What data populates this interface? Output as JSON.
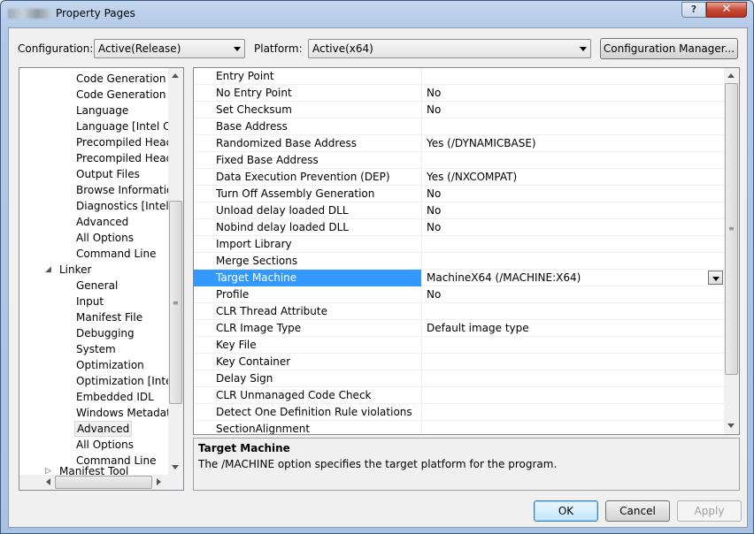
{
  "window": {
    "title": "Property Pages"
  },
  "title_buttons": {
    "help": "?",
    "close": "✕"
  },
  "config": {
    "configuration_label": "Configuration:",
    "configuration_value": "Active(Release)",
    "platform_label": "Platform:",
    "platform_value": "Active(x64)",
    "manager_button": "Configuration Manager..."
  },
  "tree": {
    "items": [
      {
        "label": "Code Generation"
      },
      {
        "label": "Code Generation [In"
      },
      {
        "label": "Language"
      },
      {
        "label": "Language [Intel C++"
      },
      {
        "label": "Precompiled Heade"
      },
      {
        "label": "Precompiled Heade"
      },
      {
        "label": "Output Files"
      },
      {
        "label": "Browse Information"
      },
      {
        "label": "Diagnostics [Intel C"
      },
      {
        "label": "Advanced"
      },
      {
        "label": "All Options"
      },
      {
        "label": "Command Line"
      },
      {
        "label": "Linker"
      },
      {
        "label": "General"
      },
      {
        "label": "Input"
      },
      {
        "label": "Manifest File"
      },
      {
        "label": "Debugging"
      },
      {
        "label": "System"
      },
      {
        "label": "Optimization"
      },
      {
        "label": "Optimization [Intel C"
      },
      {
        "label": "Embedded IDL"
      },
      {
        "label": "Windows Metadata"
      },
      {
        "label": "Advanced"
      },
      {
        "label": "All Options"
      },
      {
        "label": "Command Line"
      },
      {
        "label": "Manifest Tool"
      }
    ]
  },
  "properties": [
    {
      "name": "Entry Point",
      "value": ""
    },
    {
      "name": "No Entry Point",
      "value": "No"
    },
    {
      "name": "Set Checksum",
      "value": "No"
    },
    {
      "name": "Base Address",
      "value": ""
    },
    {
      "name": "Randomized Base Address",
      "value": "Yes (/DYNAMICBASE)"
    },
    {
      "name": "Fixed Base Address",
      "value": ""
    },
    {
      "name": "Data Execution Prevention (DEP)",
      "value": "Yes (/NXCOMPAT)"
    },
    {
      "name": "Turn Off Assembly Generation",
      "value": "No"
    },
    {
      "name": "Unload delay loaded DLL",
      "value": "No"
    },
    {
      "name": "Nobind delay loaded DLL",
      "value": "No"
    },
    {
      "name": "Import Library",
      "value": ""
    },
    {
      "name": "Merge Sections",
      "value": ""
    },
    {
      "name": "Target Machine",
      "value": "MachineX64 (/MACHINE:X64)"
    },
    {
      "name": "Profile",
      "value": "No"
    },
    {
      "name": "CLR Thread Attribute",
      "value": ""
    },
    {
      "name": "CLR Image Type",
      "value": "Default image type"
    },
    {
      "name": "Key File",
      "value": ""
    },
    {
      "name": "Key Container",
      "value": ""
    },
    {
      "name": "Delay Sign",
      "value": ""
    },
    {
      "name": "CLR Unmanaged Code Check",
      "value": ""
    },
    {
      "name": "Detect One Definition Rule violations",
      "value": ""
    },
    {
      "name": "SectionAlignment",
      "value": ""
    }
  ],
  "description": {
    "title": "Target Machine",
    "text": "The /MACHINE option specifies the target platform for the program."
  },
  "buttons": {
    "ok": "OK",
    "cancel": "Cancel",
    "apply": "Apply"
  }
}
